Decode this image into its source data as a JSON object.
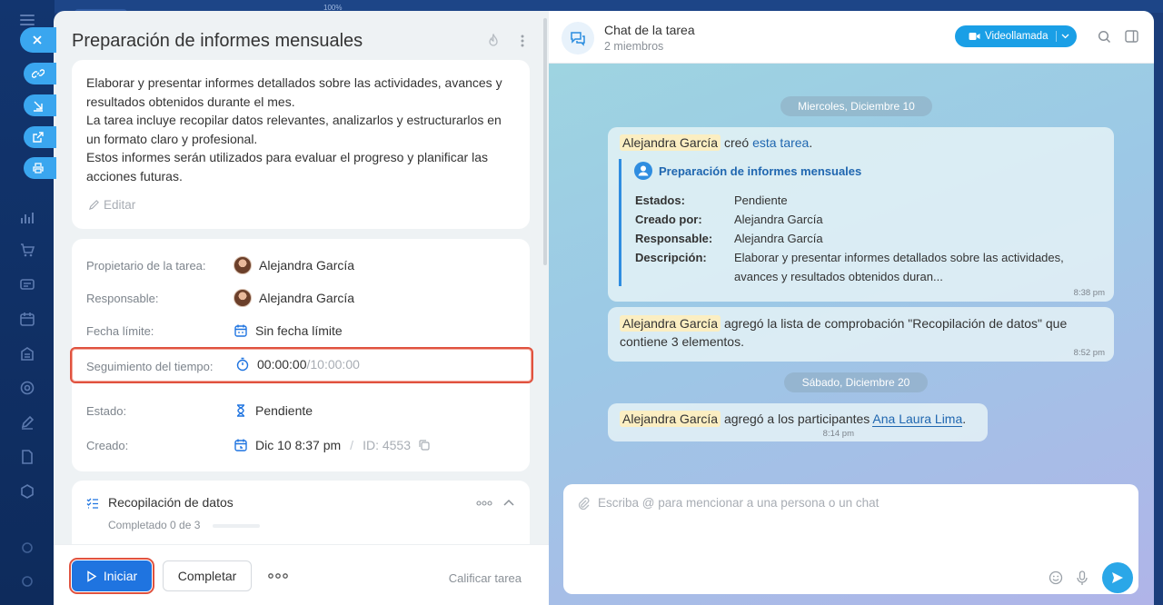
{
  "background": {
    "zoom_label": "100%"
  },
  "task": {
    "title": "Preparación de informes mensuales",
    "description_lines": [
      "Elaborar y presentar informes detallados sobre las actividades, avances y",
      "resultados obtenidos durante el mes.",
      "La tarea incluye recopilar datos relevantes, analizarlos y estructurarlos en",
      "un formato claro y profesional.",
      "Estos informes serán utilizados para evaluar el progreso y planificar las",
      "acciones futuras."
    ],
    "edit_label": "Editar",
    "fields": {
      "owner_label": "Propietario de la tarea:",
      "owner_value": "Alejandra García",
      "responsible_label": "Responsable:",
      "responsible_value": "Alejandra García",
      "deadline_label": "Fecha límite:",
      "deadline_value": "Sin fecha límite",
      "tracking_label": "Seguimiento del tiempo:",
      "tracking_value": "00:00:00",
      "tracking_limit": "/10:00:00",
      "status_label": "Estado:",
      "status_value": "Pendiente",
      "created_label": "Creado:",
      "created_value": "Dic 10 8:37 pm",
      "id_sep": "/",
      "id_value": "ID: 4553"
    },
    "checklist": {
      "title": "Recopilación de datos",
      "progress_text": "Completado 0 de 3",
      "completed": 0,
      "total": 3
    },
    "footer": {
      "start_label": "Iniciar",
      "complete_label": "Completar",
      "rate_label": "Calificar tarea"
    }
  },
  "chat": {
    "title": "Chat de la tarea",
    "subtitle": "2 miembros",
    "video_label": "Videollamada",
    "messages": [
      {
        "date": "Miercoles, Diciembre 10",
        "author": "Alejandra García",
        "text": "creó",
        "link": "esta tarea",
        "after_link": ".",
        "quote": {
          "title": "Preparación de informes mensuales",
          "rows": [
            {
              "label": "Estados:",
              "value": "Pendiente"
            },
            {
              "label": "Creado por:",
              "value": "Alejandra García"
            },
            {
              "label": "Responsable:",
              "value": "Alejandra García"
            },
            {
              "label": "Descripción:",
              "value": "Elaborar y presentar informes detallados sobre las actividades, avances y resultados obtenidos duran..."
            }
          ]
        },
        "time": "8:38 pm"
      },
      {
        "author": "Alejandra García",
        "text": "agregó la lista de comprobación \"Recopilación de datos\" que",
        "text2": "contiene 3 elementos.",
        "time": "8:52 pm"
      },
      {
        "date": "Sábado, Diciembre 20",
        "author": "Alejandra García",
        "text": "agregó a los participantes",
        "link": "Ana Laura Lima",
        "after_link": ".",
        "time": "8:14 pm"
      }
    ],
    "input_placeholder": "Escriba @ para mencionar a una persona o un chat"
  },
  "colors": {
    "accent": "#1f74e0",
    "highlight": "#e0523f",
    "chat_button": "#1a9fe6",
    "link": "#2067b0"
  }
}
